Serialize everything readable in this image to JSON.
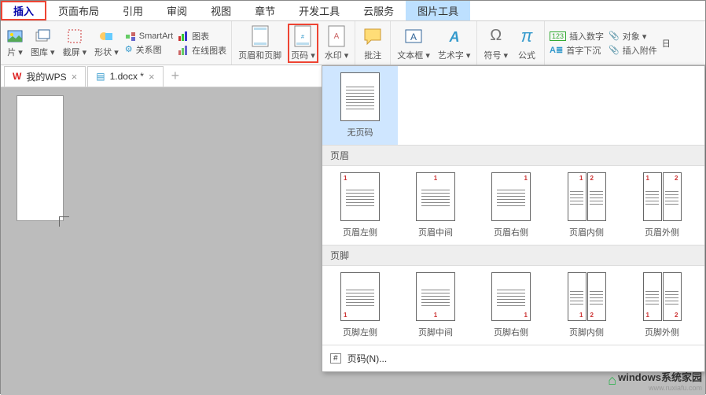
{
  "tabs": {
    "insert": "插入",
    "layout": "页面布局",
    "reference": "引用",
    "review": "审阅",
    "view": "视图",
    "chapter": "章节",
    "dev": "开发工具",
    "cloud": "云服务",
    "picture": "图片工具"
  },
  "ribbon": {
    "pic": "片 ▾",
    "gallery": "图库 ▾",
    "screenshot": "截屏 ▾",
    "shapes": "形状 ▾",
    "smartart": "SmartArt",
    "chart": "图表",
    "relation": "关系图",
    "onlinechart": "在线图表",
    "headerfooter": "页眉和页脚",
    "pagenum": "页码 ▾",
    "watermark": "水印 ▾",
    "comment": "批注",
    "textbox": "文本框 ▾",
    "wordart": "艺术字 ▾",
    "symbol": "符号 ▾",
    "formula": "公式",
    "insertnum": "插入数字",
    "object": "对象 ▾",
    "dropcap": "首字下沉",
    "attach": "插入附件",
    "date": "日"
  },
  "doc": {
    "wps": "我的WPS",
    "file": "1.docx *"
  },
  "dd": {
    "none": "无页码",
    "sect_header": "页眉",
    "sect_footer": "页脚",
    "h_left": "页眉左侧",
    "h_center": "页眉中间",
    "h_right": "页眉右侧",
    "h_inner": "页眉内侧",
    "h_outer": "页眉外侧",
    "f_left": "页脚左侧",
    "f_center": "页脚中间",
    "f_right": "页脚右侧",
    "f_inner": "页脚内侧",
    "f_outer": "页脚外侧",
    "more": "页码(N)..."
  },
  "watermark": {
    "brand": "windows系统家园",
    "url": "www.ruxiafu.com"
  }
}
